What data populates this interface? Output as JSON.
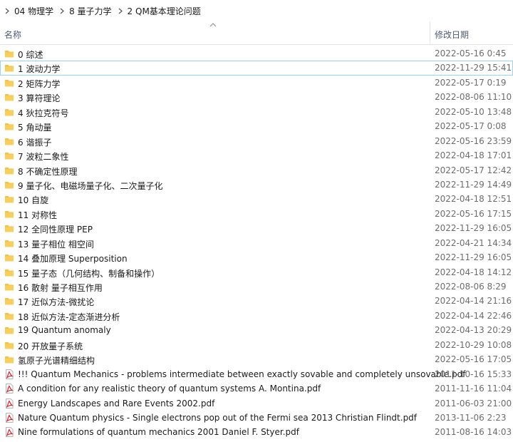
{
  "breadcrumb": [
    "04 物理学",
    "8 量子力学",
    "2 QM基本理论问题"
  ],
  "columns": {
    "name": "名称",
    "date": "修改日期"
  },
  "colors": {
    "folder": "#f5c244",
    "pdf": "#d9232a",
    "header_text": "#4d5b72"
  },
  "items": [
    {
      "type": "folder",
      "name": "0 综述",
      "date": "2022-05-16 0:45"
    },
    {
      "type": "folder",
      "name": "1 波动力学",
      "date": "2022-11-29 15:41"
    },
    {
      "type": "folder",
      "name": "2 矩阵力学",
      "date": "2022-05-17 0:19"
    },
    {
      "type": "folder",
      "name": "3 算符理论",
      "date": "2022-08-06 11:10"
    },
    {
      "type": "folder",
      "name": "4 狄拉克符号",
      "date": "2022-05-10 13:48"
    },
    {
      "type": "folder",
      "name": "5 角动量",
      "date": "2022-05-17 0:08"
    },
    {
      "type": "folder",
      "name": "6 谐振子",
      "date": "2022-05-16 23:59"
    },
    {
      "type": "folder",
      "name": "7 波粒二象性",
      "date": "2022-04-18 17:01"
    },
    {
      "type": "folder",
      "name": "8 不确定性原理",
      "date": "2022-05-17 12:42"
    },
    {
      "type": "folder",
      "name": "9 量子化、电磁场量子化、二次量子化",
      "date": "2022-11-29 14:49"
    },
    {
      "type": "folder",
      "name": "10 自旋",
      "date": "2022-04-18 12:51"
    },
    {
      "type": "folder",
      "name": "11 对称性",
      "date": "2022-05-16 17:15"
    },
    {
      "type": "folder",
      "name": "12 全同性原理 PEP",
      "date": "2022-11-29 16:05"
    },
    {
      "type": "folder",
      "name": "13 量子相位 相空间",
      "date": "2022-04-21 14:34"
    },
    {
      "type": "folder",
      "name": "14 叠加原理 Superposition",
      "date": "2022-11-29 16:05"
    },
    {
      "type": "folder",
      "name": "15 量子态（几何结构、制备和操作）",
      "date": "2022-04-18 14:12"
    },
    {
      "type": "folder",
      "name": "16 散射 量子相互作用",
      "date": "2022-08-06 8:29"
    },
    {
      "type": "folder",
      "name": "17 近似方法-微扰论",
      "date": "2022-04-14 21:16"
    },
    {
      "type": "folder",
      "name": "18 近似方法-定态渐进分析",
      "date": "2022-04-14 22:46"
    },
    {
      "type": "folder",
      "name": "19 Quantum anomaly",
      "date": "2022-04-13 20:29"
    },
    {
      "type": "folder",
      "name": "20 开放量子系统",
      "date": "2022-10-29 10:08"
    },
    {
      "type": "folder",
      "name": "氢原子光谱精细结构",
      "date": "2022-05-16 17:05"
    },
    {
      "type": "pdf",
      "name": "!!! Quantum Mechanics - problems intermediate between exactly sovable and completely unsovable.pdf",
      "date": "2011-10-16 15:33"
    },
    {
      "type": "pdf",
      "name": "A condition for any realistic theory of quantum systems   A. Montina.pdf",
      "date": "2011-11-16 11:04"
    },
    {
      "type": "pdf",
      "name": "Energy Landscapes and Rare Events 2002.pdf",
      "date": "2011-06-03 21:00"
    },
    {
      "type": "pdf",
      "name": "Nature   Quantum physics - Single electrons pop out of the Fermi sea  2013 Christian Flindt.pdf",
      "date": "2013-11-06 2:23"
    },
    {
      "type": "pdf",
      "name": "Nine formulations of quantum mechanics   2001 Daniel F. Styer.pdf",
      "date": "2011-08-16 14:03"
    }
  ]
}
